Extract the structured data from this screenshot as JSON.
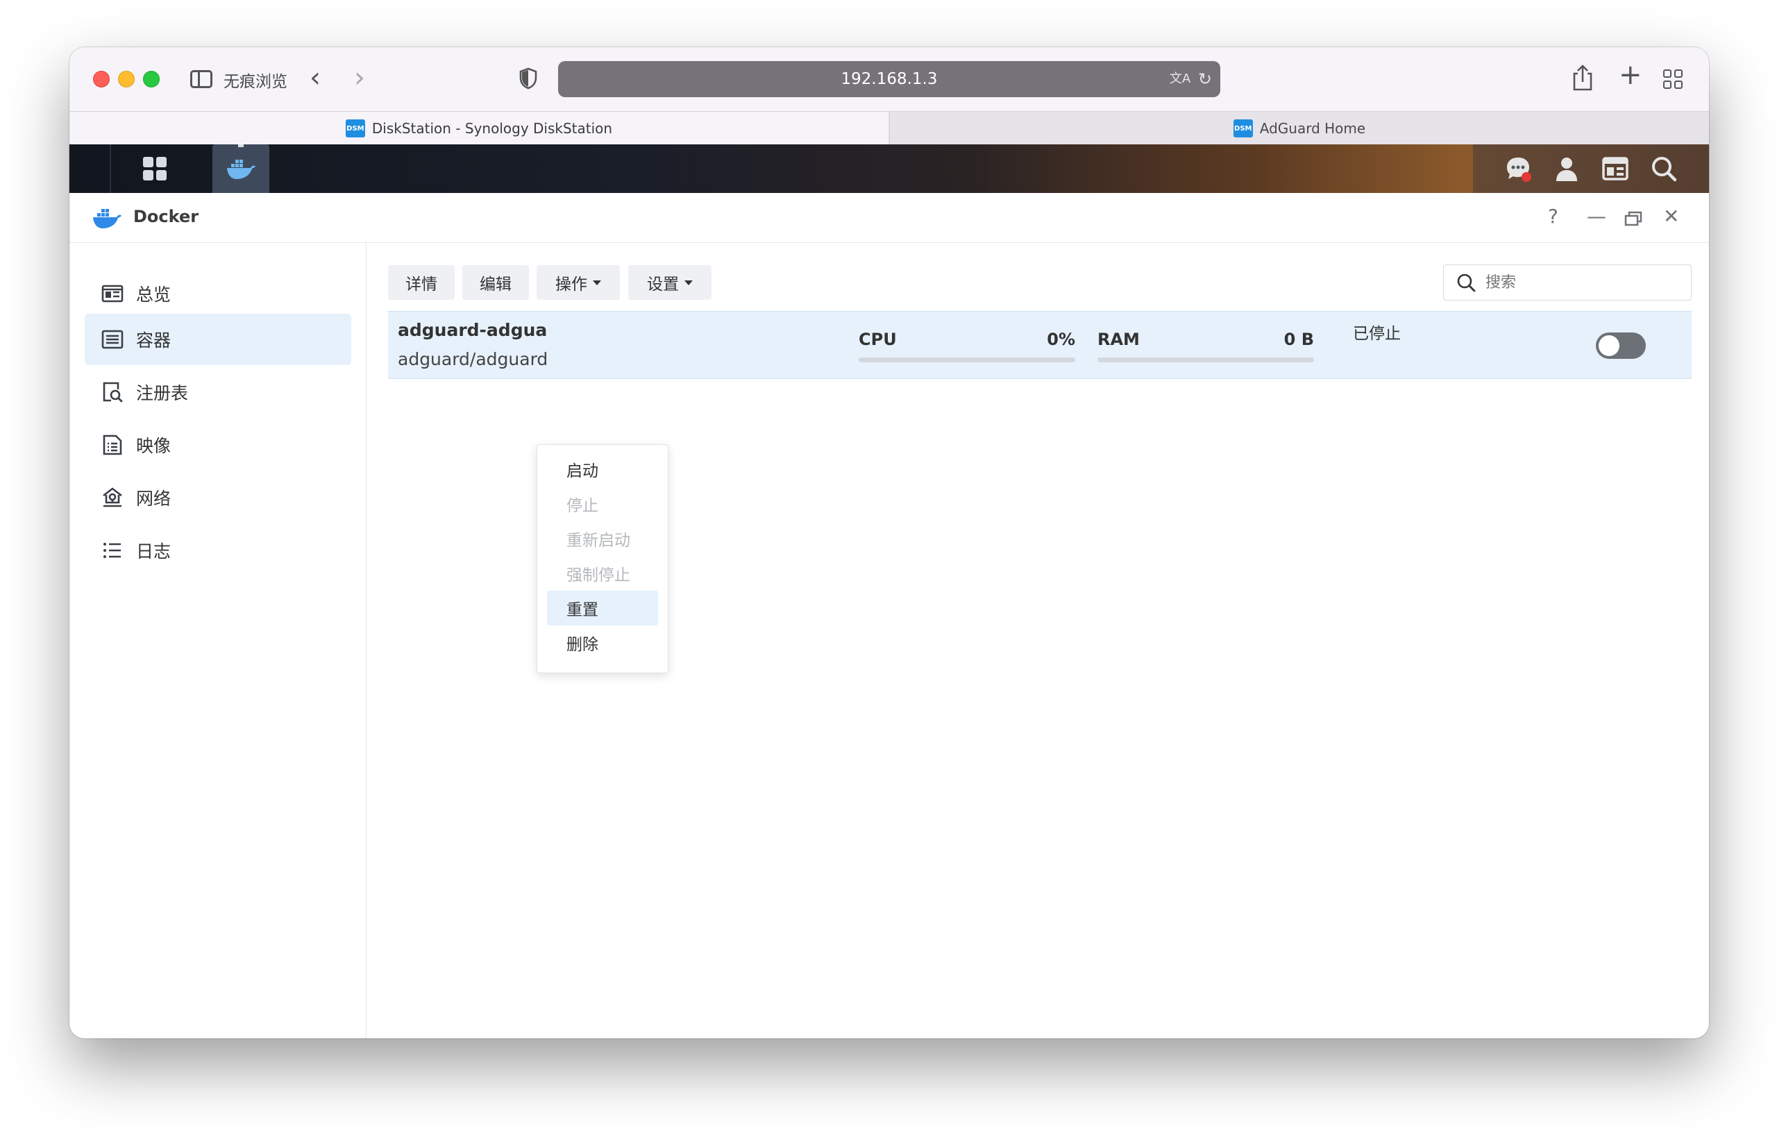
{
  "browser": {
    "private_label": "无痕浏览",
    "address": "192.168.1.3",
    "tabs": [
      {
        "badge": "DSM",
        "title": "DiskStation - Synology DiskStation"
      },
      {
        "badge": "DSM",
        "title": "AdGuard Home"
      }
    ]
  },
  "app": {
    "title": "Docker",
    "help_label": "?"
  },
  "sidebar": {
    "items": [
      {
        "label": "总览",
        "icon": "overview-icon"
      },
      {
        "label": "容器",
        "icon": "container-icon",
        "active": true
      },
      {
        "label": "注册表",
        "icon": "registry-icon"
      },
      {
        "label": "映像",
        "icon": "image-icon"
      },
      {
        "label": "网络",
        "icon": "network-icon"
      },
      {
        "label": "日志",
        "icon": "log-icon"
      }
    ]
  },
  "toolbar": {
    "details": "详情",
    "edit": "编辑",
    "action": "操作",
    "settings": "设置",
    "search_placeholder": "搜索"
  },
  "container": {
    "name": "adguard-adgua",
    "image": "adguard/adguard",
    "cpu_label": "CPU",
    "cpu_value": "0%",
    "cpu_fraction": 0,
    "ram_label": "RAM",
    "ram_value": "0 B",
    "ram_fraction": 0,
    "status": "已停止",
    "running": false
  },
  "action_menu": {
    "items": [
      {
        "label": "启动",
        "enabled": true
      },
      {
        "label": "停止",
        "enabled": false
      },
      {
        "label": "重新启动",
        "enabled": false
      },
      {
        "label": "强制停止",
        "enabled": false
      },
      {
        "label": "重置",
        "enabled": true,
        "highlighted": true
      },
      {
        "label": "删除",
        "enabled": true
      }
    ]
  },
  "colors": {
    "accent": "#2e8ae6",
    "selected_bg": "#e6f1fc",
    "notification_dot": "#e53935"
  }
}
